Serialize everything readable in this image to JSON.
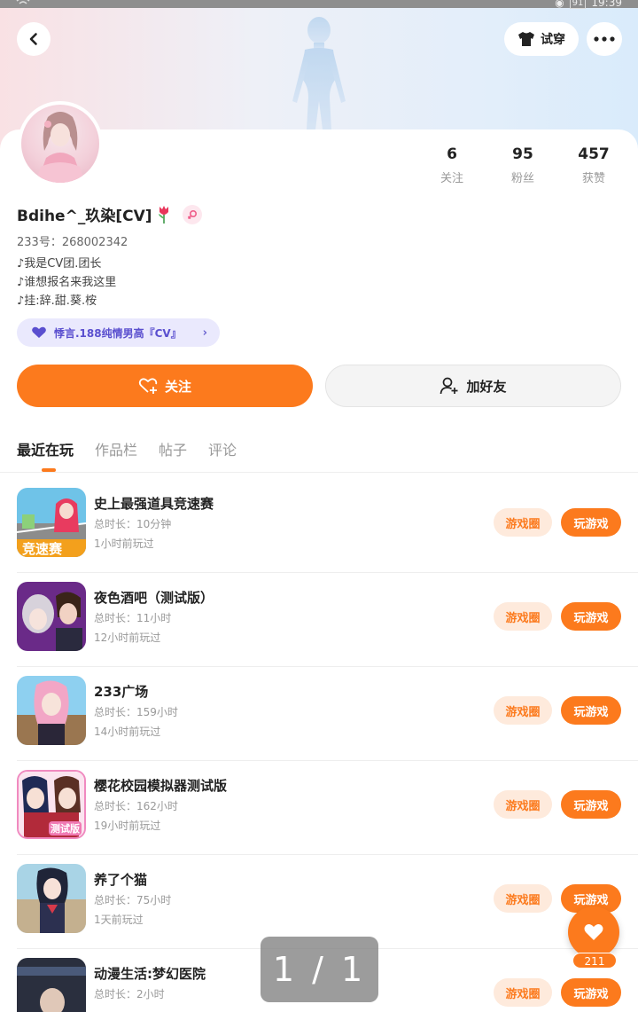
{
  "status_bar": {
    "battery": "91",
    "time": "19:39"
  },
  "header": {
    "tryon_label": "试穿"
  },
  "profile": {
    "nickname": "Bdihe^_玖染[CV]",
    "uid": "233号：268002342",
    "bio": [
      "♪我是CV团.团长",
      "♪谁想报名来我这里",
      "♪挂:辞.甜.葵.桉"
    ],
    "tag": "悸言.188纯情男高『CV』"
  },
  "stats": [
    {
      "value": "6",
      "label": "关注"
    },
    {
      "value": "95",
      "label": "粉丝"
    },
    {
      "value": "457",
      "label": "获赞"
    }
  ],
  "actions": {
    "follow_label": "关注",
    "add_friend_label": "加好友"
  },
  "tabs": [
    "最近在玩",
    "作品栏",
    "帖子",
    "评论"
  ],
  "active_tab": "最近在玩",
  "games": [
    {
      "title": "史上最强道具竞速赛",
      "duration": "总时长：10分钟",
      "last_played": "1小时前玩过",
      "icon_text": "竞速赛"
    },
    {
      "title": "夜色酒吧（测试版）",
      "duration": "总时长：11小时",
      "last_played": "12小时前玩过"
    },
    {
      "title": "233广场",
      "duration": "总时长：159小时",
      "last_played": "14小时前玩过"
    },
    {
      "title": "樱花校园模拟器测试版",
      "duration": "总时长：162小时",
      "last_played": "19小时前玩过",
      "icon_text": "测试版"
    },
    {
      "title": "养了个猫",
      "duration": "总时长：75小时",
      "last_played": "1天前玩过"
    },
    {
      "title": "动漫生活:梦幻医院",
      "duration": "总时长：2小时",
      "last_played": ""
    }
  ],
  "game_buttons": {
    "circle_label": "游戏圈",
    "play_label": "玩游戏"
  },
  "page_indicator": "1 / 1",
  "like_count": "211",
  "colors": {
    "accent": "#fc7a1d",
    "accent_light": "#feeadc",
    "tag_bg": "#eae9fd"
  }
}
